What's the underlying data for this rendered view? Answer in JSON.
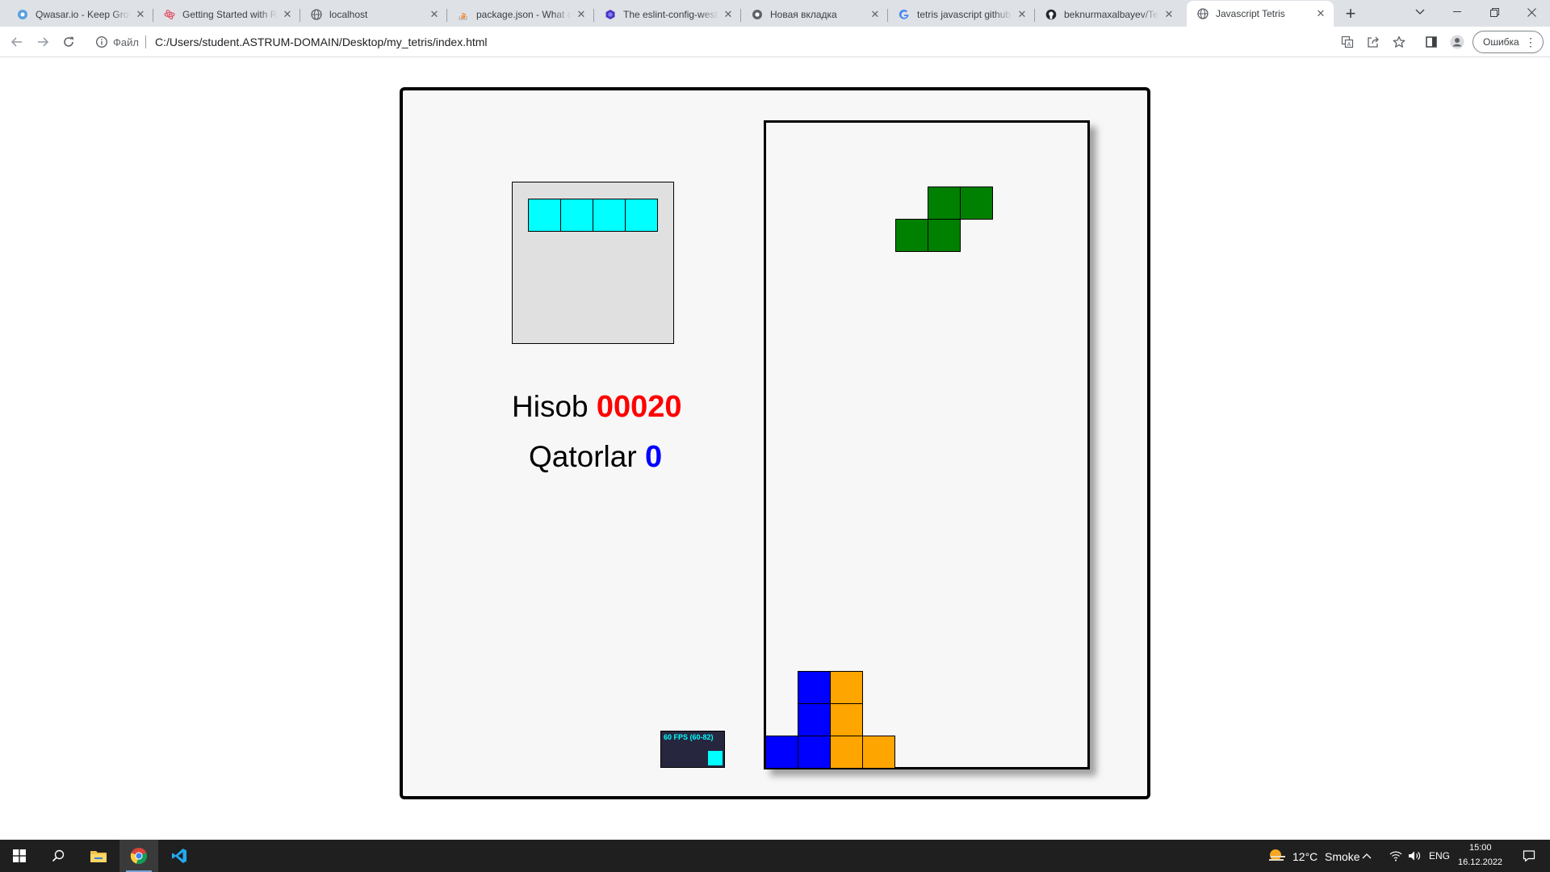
{
  "browser": {
    "tabs": [
      {
        "title": "Qwasar.io - Keep Growing",
        "icon": "qwasar-icon",
        "active": false
      },
      {
        "title": "Getting Started with React",
        "icon": "react-icon",
        "active": false
      },
      {
        "title": "localhost",
        "icon": "globe-icon",
        "active": false
      },
      {
        "title": "package.json - What does",
        "icon": "stackoverflow-icon",
        "active": false
      },
      {
        "title": "The eslint-config-wesbos",
        "icon": "eslint-icon",
        "active": false
      },
      {
        "title": "Новая вкладка",
        "icon": "chrome-icon",
        "active": false
      },
      {
        "title": "tetris javascript github",
        "icon": "google-icon",
        "active": false
      },
      {
        "title": "beknurmaxalbayev/Tetris",
        "icon": "github-icon",
        "active": true
      },
      {
        "title": "Javascript Tetris",
        "icon": "globe-icon",
        "active": true
      }
    ],
    "address": {
      "scheme_label": "Файл",
      "url": "C:/Users/student.ASTRUM-DOMAIN/Desktop/my_tetris/index.html"
    },
    "error_button_label": "Ошибка"
  },
  "game": {
    "score_label": "Hisob",
    "score_value": "00020",
    "lines_label": "Qatorlar",
    "lines_value": "0",
    "fps_text": "60 FPS (60-82)",
    "colors": {
      "I": "#00ffff",
      "S": "#008000",
      "J": "#0000ff",
      "L": "#ffa500",
      "score": "#ff0000",
      "lines": "#0000ff",
      "board_bg": "#f7f7f7",
      "preview_bg": "#e0e0e0"
    },
    "next_piece": {
      "type": "I",
      "color": "cyan",
      "cells": [
        [
          0,
          1
        ],
        [
          1,
          1
        ],
        [
          2,
          1
        ],
        [
          3,
          1
        ]
      ]
    },
    "board": {
      "columns": 10,
      "rows": 20,
      "falling_piece": {
        "type": "S",
        "color": "green",
        "cells": [
          [
            5,
            2
          ],
          [
            6,
            2
          ],
          [
            4,
            3
          ],
          [
            5,
            3
          ]
        ]
      },
      "locked_cells": [
        {
          "col": 1,
          "row": 17,
          "color": "blue"
        },
        {
          "col": 1,
          "row": 18,
          "color": "blue"
        },
        {
          "col": 0,
          "row": 19,
          "color": "blue"
        },
        {
          "col": 1,
          "row": 19,
          "color": "blue"
        },
        {
          "col": 2,
          "row": 17,
          "color": "orange"
        },
        {
          "col": 2,
          "row": 18,
          "color": "orange"
        },
        {
          "col": 2,
          "row": 19,
          "color": "orange"
        },
        {
          "col": 3,
          "row": 19,
          "color": "orange"
        }
      ]
    }
  },
  "taskbar": {
    "apps": [
      "start-icon",
      "search-icon",
      "file-explorer-icon",
      "chrome-icon",
      "vscode-icon"
    ],
    "weather": {
      "temperature": "12°C",
      "condition": "Smoke"
    },
    "language": "ENG",
    "time": "15:00",
    "date": "16.12.2022"
  }
}
